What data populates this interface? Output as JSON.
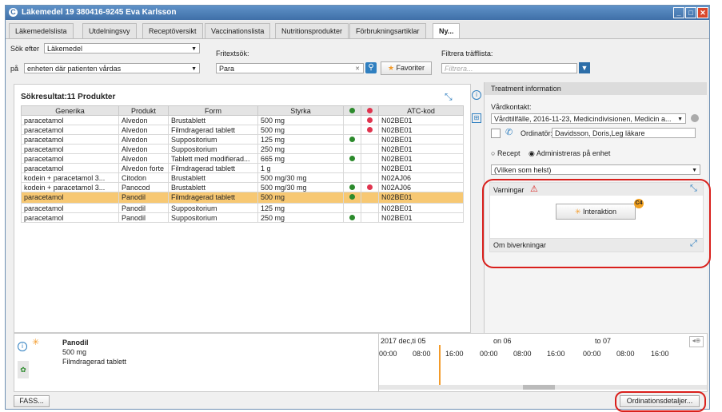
{
  "window": {
    "title": "Läkemedel 19 380416-9245 Eva Karlsson"
  },
  "tabs": [
    "Läkemedelslista",
    "Utdelningsvy",
    "Receptöversikt",
    "Vaccinationslista",
    "Nutritionsprodukter",
    "Förbrukningsartiklar",
    "Ny..."
  ],
  "search": {
    "sok_efter_label": "Sök efter",
    "sok_efter_value": "Läkemedel",
    "pa_label": "på",
    "pa_value": "enheten där patienten vårdas",
    "fritext_label": "Fritextsök:",
    "fritext_value": "Para",
    "favoriter_label": "Favoriter",
    "filter_label": "Filtrera träfflista:",
    "filter_placeholder": "Filtrera..."
  },
  "results": {
    "title": "Sökresultat:11 Produkter",
    "columns": [
      "Generika",
      "Produkt",
      "Form",
      "Styrka",
      "",
      "",
      "ATC-kod"
    ],
    "rows": [
      {
        "generika": "paracetamol",
        "produkt": "Alvedon",
        "form": "Brustablett",
        "styrka": "500 mg",
        "g": false,
        "r": true,
        "atc": "N02BE01"
      },
      {
        "generika": "paracetamol",
        "produkt": "Alvedon",
        "form": "Filmdragerad tablett",
        "styrka": "500 mg",
        "g": false,
        "r": true,
        "atc": "N02BE01"
      },
      {
        "generika": "paracetamol",
        "produkt": "Alvedon",
        "form": "Suppositorium",
        "styrka": "125 mg",
        "g": true,
        "r": false,
        "atc": "N02BE01"
      },
      {
        "generika": "paracetamol",
        "produkt": "Alvedon",
        "form": "Suppositorium",
        "styrka": "250 mg",
        "g": false,
        "r": false,
        "atc": "N02BE01"
      },
      {
        "generika": "paracetamol",
        "produkt": "Alvedon",
        "form": "Tablett med modifierad...",
        "styrka": "665 mg",
        "g": true,
        "r": false,
        "atc": "N02BE01"
      },
      {
        "generika": "paracetamol",
        "produkt": "Alvedon forte",
        "form": "Filmdragerad tablett",
        "styrka": "1 g",
        "g": false,
        "r": false,
        "atc": "N02BE01"
      },
      {
        "generika": "kodein + paracetamol 3...",
        "produkt": "Citodon",
        "form": "Brustablett",
        "styrka": "500 mg/30 mg",
        "g": false,
        "r": false,
        "atc": "N02AJ06"
      },
      {
        "generika": "kodein + paracetamol 3...",
        "produkt": "Panocod",
        "form": "Brustablett",
        "styrka": "500 mg/30 mg",
        "g": true,
        "r": true,
        "atc": "N02AJ06"
      },
      {
        "generika": "paracetamol",
        "produkt": "Panodil",
        "form": "Filmdragerad tablett",
        "styrka": "500 mg",
        "g": true,
        "r": false,
        "atc": "N02BE01",
        "selected": true
      },
      {
        "generika": "paracetamol",
        "produkt": "Panodil",
        "form": "Suppositorium",
        "styrka": "125 mg",
        "g": false,
        "r": false,
        "atc": "N02BE01"
      },
      {
        "generika": "paracetamol",
        "produkt": "Panodil",
        "form": "Suppositorium",
        "styrka": "250 mg",
        "g": true,
        "r": false,
        "atc": "N02BE01"
      }
    ]
  },
  "treatment": {
    "header": "Treatment information",
    "vardkontakt_label": "Vårdkontakt:",
    "vardkontakt_value": "Vårdtillfälle, 2016-11-23, Medicindivisionen, Medicin a...",
    "ordinator_label": "Ordinatör:",
    "ordinator_value": "Davidsson, Doris,Leg läkare",
    "recept_label": "Recept",
    "administreras_label": "Administreras på enhet",
    "vilken_value": "(Vilken som helst)",
    "varningar_label": "Varningar",
    "interaktion_label": "Interaktion",
    "interaktion_badge": "C4",
    "biverkningar_label": "Om biverkningar"
  },
  "bottom": {
    "product_name": "Panodil",
    "product_dose": "500 mg",
    "product_form": "Filmdragerad tablett",
    "date1": "2017 dec,ti 05",
    "date2": "on 06",
    "date3": "to 07",
    "times": [
      "00:00",
      "08:00",
      "16:00",
      "00:00",
      "08:00",
      "16:00",
      "00:00",
      "08:00",
      "16:00"
    ],
    "fass_label": "FASS...",
    "ordination_label": "Ordinationsdetaljer..."
  }
}
